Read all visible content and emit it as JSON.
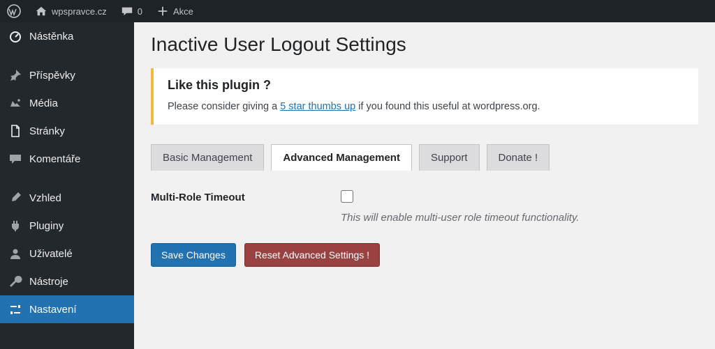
{
  "adminbar": {
    "site_name": "wpspravce.cz",
    "comment_count": "0",
    "new_label": "Akce"
  },
  "sidebar": {
    "items": [
      {
        "label": "Nástěnka",
        "icon": "dashboard"
      },
      {
        "label": "Příspěvky",
        "icon": "pin"
      },
      {
        "label": "Média",
        "icon": "media"
      },
      {
        "label": "Stránky",
        "icon": "page"
      },
      {
        "label": "Komentáře",
        "icon": "comment"
      }
    ],
    "items2": [
      {
        "label": "Vzhled",
        "icon": "brush"
      },
      {
        "label": "Pluginy",
        "icon": "plug"
      },
      {
        "label": "Uživatelé",
        "icon": "user"
      },
      {
        "label": "Nástroje",
        "icon": "wrench"
      },
      {
        "label": "Nastavení",
        "icon": "sliders",
        "active": true
      }
    ]
  },
  "page": {
    "title": "Inactive User Logout Settings",
    "notice": {
      "heading": "Like this plugin ?",
      "before_link": "Please consider giving a ",
      "link": "5 star thumbs up",
      "after_link": " if you found this useful at wordpress.org."
    },
    "tabs": [
      {
        "label": "Basic Management"
      },
      {
        "label": "Advanced Management",
        "active": true
      },
      {
        "label": "Support"
      },
      {
        "label": "Donate !"
      }
    ],
    "setting": {
      "label": "Multi-Role Timeout",
      "description": "This will enable multi-user role timeout functionality."
    },
    "buttons": {
      "save": "Save Changes",
      "reset": "Reset Advanced Settings !"
    }
  }
}
